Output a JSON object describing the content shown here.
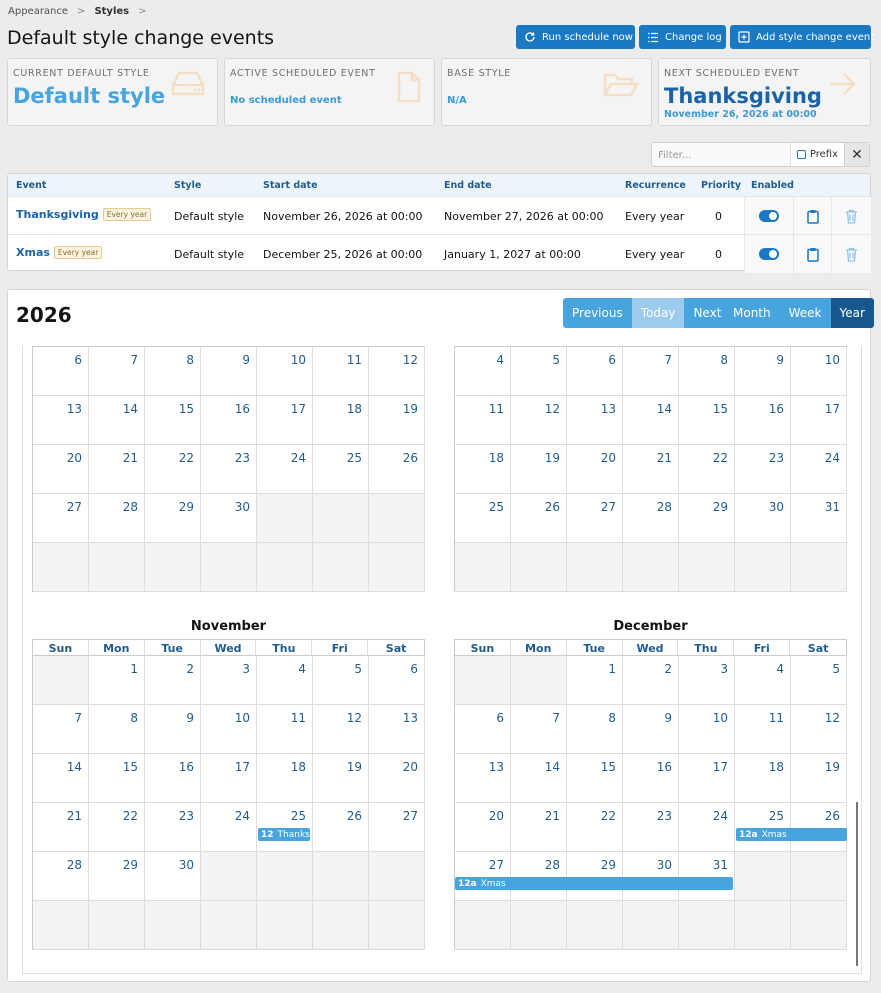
{
  "breadcrumb": {
    "items": [
      "Appearance",
      "Styles"
    ],
    "separator": ">"
  },
  "page_title": "Default style change events",
  "toolbar": {
    "run_label": "Run schedule now",
    "changelog_label": "Change log",
    "add_label": "Add style change event"
  },
  "cards": {
    "current_default": {
      "label": "CURRENT DEFAULT STYLE",
      "value": "Default style"
    },
    "active_event": {
      "label": "ACTIVE SCHEDULED EVENT",
      "value": "No scheduled event"
    },
    "base_style": {
      "label": "BASE STYLE",
      "value": "N/A"
    },
    "next_event": {
      "label": "NEXT SCHEDULED EVENT",
      "value": "Thanksgiving",
      "sub": "November 26, 2026 at 00:00"
    }
  },
  "filter": {
    "placeholder": "Filter...",
    "prefix_label": "Prefix",
    "clear": "✕"
  },
  "table": {
    "headers": {
      "event": "Event",
      "style": "Style",
      "start": "Start date",
      "end": "End date",
      "recurrence": "Recurrence",
      "priority": "Priority",
      "enabled": "Enabled"
    },
    "rows": [
      {
        "event": "Thanksgiving",
        "badge": "Every year",
        "style": "Default style",
        "start": "November 26, 2026 at 00:00",
        "end": "November 27, 2026 at 00:00",
        "recurrence": "Every year",
        "priority": "0"
      },
      {
        "event": "Xmas",
        "badge": "Every year",
        "style": "Default style",
        "start": "December 25, 2026 at 00:00",
        "end": "January 1, 2027 at 00:00",
        "recurrence": "Every year",
        "priority": "0"
      }
    ]
  },
  "calendar": {
    "year": "2026",
    "nav": {
      "previous": "Previous",
      "today": "Today",
      "next": "Next"
    },
    "views": {
      "month": "Month",
      "week": "Week",
      "year": "Year"
    },
    "dow": [
      "Sun",
      "Mon",
      "Tue",
      "Wed",
      "Thu",
      "Fri",
      "Sat"
    ],
    "upper_left": [
      [
        "6",
        "7",
        "8",
        "9",
        "10",
        "11",
        "12"
      ],
      [
        "13",
        "14",
        "15",
        "16",
        "17",
        "18",
        "19"
      ],
      [
        "20",
        "21",
        "22",
        "23",
        "24",
        "25",
        "26"
      ],
      [
        "27",
        "28",
        "29",
        "30",
        "",
        "",
        ""
      ],
      [
        "",
        "",
        "",
        "",
        "",
        "",
        ""
      ]
    ],
    "upper_right": [
      [
        "4",
        "5",
        "6",
        "7",
        "8",
        "9",
        "10"
      ],
      [
        "11",
        "12",
        "13",
        "14",
        "15",
        "16",
        "17"
      ],
      [
        "18",
        "19",
        "20",
        "21",
        "22",
        "23",
        "24"
      ],
      [
        "25",
        "26",
        "27",
        "28",
        "29",
        "30",
        "31"
      ],
      [
        "",
        "",
        "",
        "",
        "",
        "",
        ""
      ]
    ],
    "november": {
      "name": "November",
      "weeks": [
        [
          "",
          "1",
          "2",
          "3",
          "4",
          "5",
          "6"
        ],
        [
          "7",
          "8",
          "9",
          "10",
          "11",
          "12",
          "13"
        ],
        [
          "14",
          "15",
          "16",
          "17",
          "18",
          "19",
          "20"
        ],
        [
          "21",
          "22",
          "23",
          "24",
          "25",
          "26",
          "27"
        ],
        [
          "28",
          "29",
          "30",
          "",
          "",
          "",
          ""
        ],
        [
          "",
          "",
          "",
          "",
          "",
          "",
          ""
        ]
      ]
    },
    "december": {
      "name": "December",
      "weeks": [
        [
          "",
          "",
          "1",
          "2",
          "3",
          "4",
          "5"
        ],
        [
          "6",
          "7",
          "8",
          "9",
          "10",
          "11",
          "12"
        ],
        [
          "13",
          "14",
          "15",
          "16",
          "17",
          "18",
          "19"
        ],
        [
          "20",
          "21",
          "22",
          "23",
          "24",
          "25",
          "26"
        ],
        [
          "27",
          "28",
          "29",
          "30",
          "31",
          "",
          ""
        ],
        [
          "",
          "",
          "",
          "",
          "",
          "",
          ""
        ]
      ]
    },
    "events": {
      "thanksgiving": {
        "time": "12",
        "title": "Thanksgiving"
      },
      "xmas_a": {
        "time": "12a",
        "title": "Xmas"
      },
      "xmas_b": {
        "time": "12a",
        "title": "Xmas"
      }
    }
  },
  "colors": {
    "accent": "#1a79c2",
    "event": "#47a4de",
    "active_view": "#17588f"
  }
}
